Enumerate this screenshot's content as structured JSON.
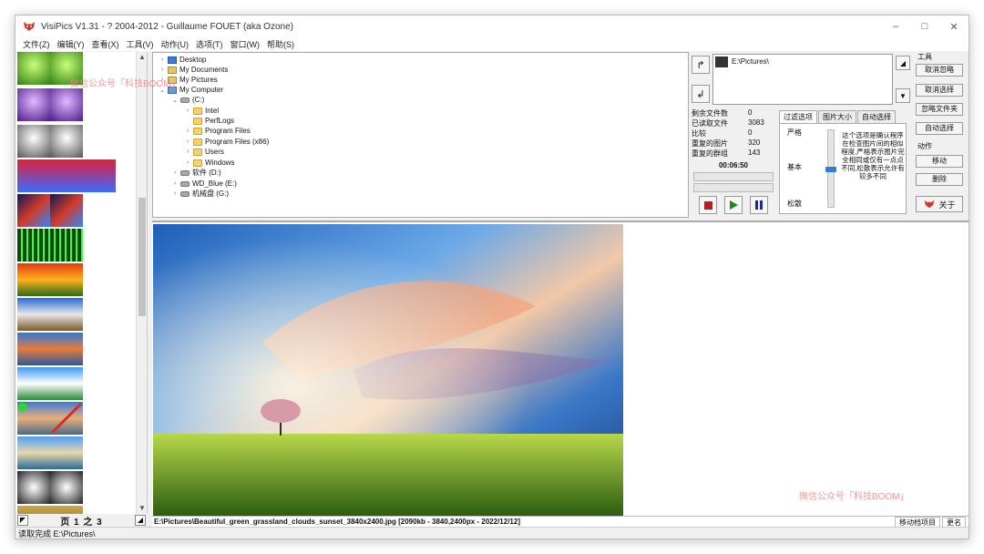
{
  "window": {
    "title": "VisiPics V1.31 - ? 2004-2012 - Guillaume FOUET (aka Ozone)"
  },
  "menu": [
    "文件(Z)",
    "编辑(Y)",
    "查看(X)",
    "工具(V)",
    "动作(U)",
    "选项(T)",
    "窗口(W)",
    "帮助(S)"
  ],
  "tree": {
    "items": [
      {
        "label": "Desktop",
        "icon": "desktop-icon"
      },
      {
        "label": "My Documents",
        "icon": "documents-icon"
      },
      {
        "label": "My Pictures",
        "icon": "pictures-icon"
      },
      {
        "label": "My Computer",
        "icon": "computer-icon"
      },
      {
        "label": "(C:)",
        "icon": "drive-icon"
      },
      {
        "label": "Intel",
        "icon": "folder-icon"
      },
      {
        "label": "PerfLogs",
        "icon": "folder-icon"
      },
      {
        "label": "Program Files",
        "icon": "folder-icon"
      },
      {
        "label": "Program Files (x86)",
        "icon": "folder-icon"
      },
      {
        "label": "Users",
        "icon": "folder-icon"
      },
      {
        "label": "Windows",
        "icon": "folder-icon"
      },
      {
        "label": "软件 (D:)",
        "icon": "drive-icon"
      },
      {
        "label": "WD_Blue (E:)",
        "icon": "drive-icon"
      },
      {
        "label": "机械盘 (G:)",
        "icon": "drive-icon"
      }
    ]
  },
  "path": {
    "selected": "E:\\Pictures\\"
  },
  "stats": {
    "rows": [
      {
        "label": "剩余文件数",
        "value": "0"
      },
      {
        "label": "已读取文件",
        "value": "3083"
      },
      {
        "label": "比较",
        "value": "0"
      },
      {
        "label": "重复的图片",
        "value": "320"
      },
      {
        "label": "重复的群组",
        "value": "143"
      }
    ],
    "elapsed": "00:06:50"
  },
  "filter": {
    "tabs": [
      "过滤选项",
      "图片大小",
      "自动选择"
    ],
    "levels": [
      "严格",
      "基本",
      "松散"
    ],
    "slider_level": 0.5,
    "description": "这个选项是确认程序在检查图片间的相似程度,严格表示图片完全相同或仅有一点点不同,松散表示允许有较多不同"
  },
  "tools": {
    "label": "工具",
    "buttons": [
      "取消忽略",
      "取消选择",
      "忽略文件夹",
      "自动选择"
    ],
    "action_label": "动作",
    "action_buttons": [
      "移动",
      "删除"
    ],
    "about": "关于"
  },
  "pager": {
    "label": "页 1 之 3"
  },
  "status": {
    "text": "读取完成 E:\\Pictures\\"
  },
  "file": {
    "info": "E:\\Pictures\\Beautiful_green_grassland_clouds_sunset_3840x2400.jpg [2090kb - 3840,2400px - 2022/12/12]",
    "right": [
      "移动档项目",
      "更名"
    ]
  },
  "watermarks": [
    "微信公众号「科技BOOM」",
    "微信公众号「科技BOOM」"
  ]
}
